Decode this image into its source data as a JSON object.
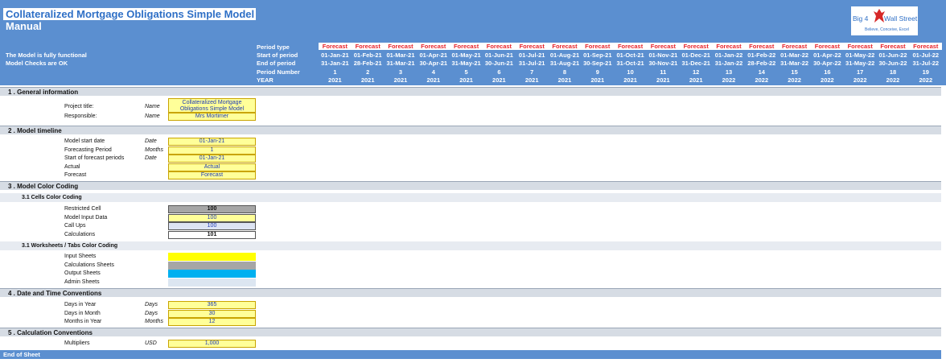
{
  "header": {
    "title": "Collateralized Mortgage Obligations Simple Model",
    "subtitle": "Manual",
    "status_line1": "The Model is fully functional",
    "status_line2": "Model Checks are OK",
    "logo": {
      "text_left": "Big 4",
      "text_right": "Wall Street",
      "tagline": "Believe, Conceive, Excel"
    },
    "row_labels": [
      "Period type",
      "Start of period",
      "End of period",
      "Period Number",
      "YEAR"
    ]
  },
  "periods": [
    {
      "type": "Forecast",
      "start": "01-Jan-21",
      "end": "31-Jan-21",
      "num": "1",
      "year": "2021"
    },
    {
      "type": "Forecast",
      "start": "01-Feb-21",
      "end": "28-Feb-21",
      "num": "2",
      "year": "2021"
    },
    {
      "type": "Forecast",
      "start": "01-Mar-21",
      "end": "31-Mar-21",
      "num": "3",
      "year": "2021"
    },
    {
      "type": "Forecast",
      "start": "01-Apr-21",
      "end": "30-Apr-21",
      "num": "4",
      "year": "2021"
    },
    {
      "type": "Forecast",
      "start": "01-May-21",
      "end": "31-May-21",
      "num": "5",
      "year": "2021"
    },
    {
      "type": "Forecast",
      "start": "01-Jun-21",
      "end": "30-Jun-21",
      "num": "6",
      "year": "2021"
    },
    {
      "type": "Forecast",
      "start": "01-Jul-21",
      "end": "31-Jul-21",
      "num": "7",
      "year": "2021"
    },
    {
      "type": "Forecast",
      "start": "01-Aug-21",
      "end": "31-Aug-21",
      "num": "8",
      "year": "2021"
    },
    {
      "type": "Forecast",
      "start": "01-Sep-21",
      "end": "30-Sep-21",
      "num": "9",
      "year": "2021"
    },
    {
      "type": "Forecast",
      "start": "01-Oct-21",
      "end": "31-Oct-21",
      "num": "10",
      "year": "2021"
    },
    {
      "type": "Forecast",
      "start": "01-Nov-21",
      "end": "30-Nov-21",
      "num": "11",
      "year": "2021"
    },
    {
      "type": "Forecast",
      "start": "01-Dec-21",
      "end": "31-Dec-21",
      "num": "12",
      "year": "2021"
    },
    {
      "type": "Forecast",
      "start": "01-Jan-22",
      "end": "31-Jan-22",
      "num": "13",
      "year": "2022"
    },
    {
      "type": "Forecast",
      "start": "01-Feb-22",
      "end": "28-Feb-22",
      "num": "14",
      "year": "2022"
    },
    {
      "type": "Forecast",
      "start": "01-Mar-22",
      "end": "31-Mar-22",
      "num": "15",
      "year": "2022"
    },
    {
      "type": "Forecast",
      "start": "01-Apr-22",
      "end": "30-Apr-22",
      "num": "16",
      "year": "2022"
    },
    {
      "type": "Forecast",
      "start": "01-May-22",
      "end": "31-May-22",
      "num": "17",
      "year": "2022"
    },
    {
      "type": "Forecast",
      "start": "01-Jun-22",
      "end": "30-Jun-22",
      "num": "18",
      "year": "2022"
    },
    {
      "type": "Forecast",
      "start": "01-Jul-22",
      "end": "31-Jul-22",
      "num": "19",
      "year": "2022"
    }
  ],
  "sections": {
    "general": {
      "title": "1 . General information",
      "project_title_label": "Project title:",
      "project_title_unit": "Name",
      "project_title_value": "Collateralized Mortgage Obligations Simple Model",
      "responsible_label": "Responsible:",
      "responsible_unit": "Name",
      "responsible_value": "Mrs Mortimer"
    },
    "timeline": {
      "title": "2 . Model timeline",
      "rows": [
        {
          "label": "Model start date",
          "unit": "Date",
          "value": "01-Jan-21"
        },
        {
          "label": "Forecasting Period",
          "unit": "Months",
          "value": "1"
        },
        {
          "label": "Start of forecast periods",
          "unit": "Date",
          "value": "01-Jan-21"
        },
        {
          "label": "Actual",
          "unit": "",
          "value": "Actual"
        },
        {
          "label": "Forecast",
          "unit": "",
          "value": "Forecast"
        }
      ]
    },
    "color": {
      "title": "3 . Model Color Coding",
      "cells_title": "3.1 Cells Color Coding",
      "cells": [
        {
          "label": "Restricted Cell",
          "value": "100",
          "bg": "#a6a6a6",
          "color": "#111111"
        },
        {
          "label": "Model Input Data",
          "value": "100",
          "bg": "#ffff99",
          "color": "#1f3bb3"
        },
        {
          "label": "Call Ups",
          "value": "100",
          "bg": "#dde4f3",
          "color": "#1f3bb3"
        },
        {
          "label": "Calculations",
          "value": "101",
          "bg": "#ffffff",
          "color": "#111111"
        }
      ],
      "sheets_title": "3.1 Worksheets / Tabs Color Coding",
      "sheets": [
        {
          "label": "Input Sheets",
          "bg": "#ffff00"
        },
        {
          "label": "Calculations Sheets",
          "bg": "#a6a6a6"
        },
        {
          "label": "Output Sheets",
          "bg": "#00b0f0"
        },
        {
          "label": "Admin Sheets",
          "bg": "#dce6f1"
        }
      ]
    },
    "datetime": {
      "title": "4 . Date and Time Conventions",
      "rows": [
        {
          "label": "Days in Year",
          "unit": "Days",
          "value": "365"
        },
        {
          "label": "Days in Month",
          "unit": "Days",
          "value": "30"
        },
        {
          "label": "Months in Year",
          "unit": "Months",
          "value": "12"
        }
      ]
    },
    "calc": {
      "title": "5 . Calculation Conventions",
      "rows": [
        {
          "label": "Multipliers",
          "unit": "USD",
          "value": "1,000"
        }
      ]
    }
  },
  "footer": {
    "end_label": "End of Sheet"
  }
}
